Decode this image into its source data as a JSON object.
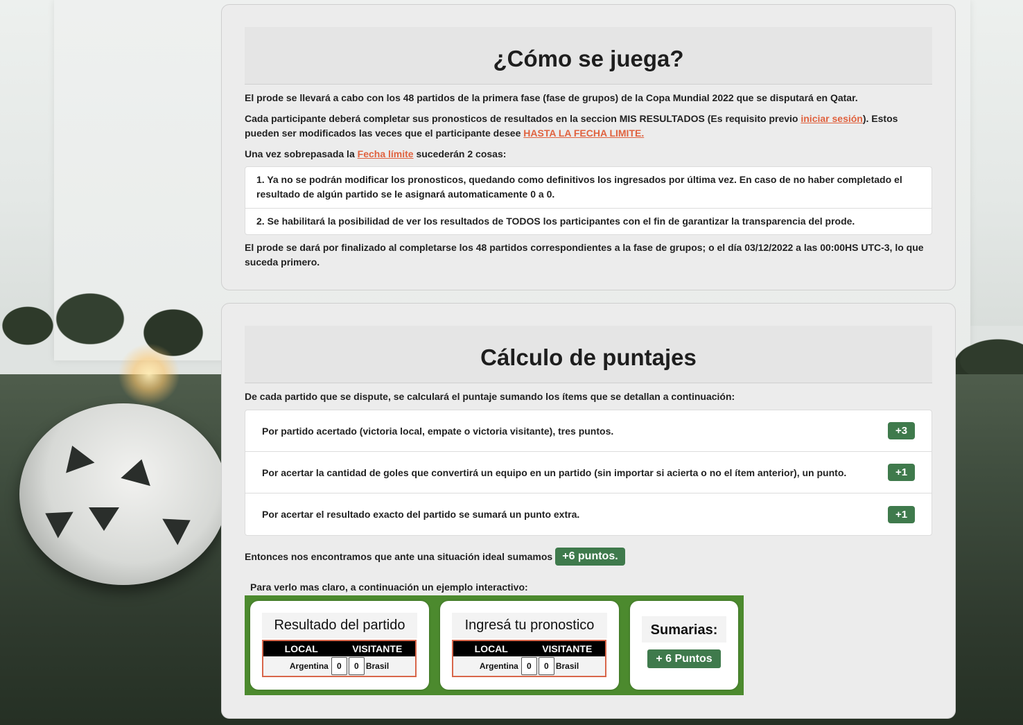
{
  "how_to_play": {
    "title": "¿Cómo se juega?",
    "p1": "El prode se llevará a cabo con los 48 partidos de la primera fase (fase de grupos) de la Copa Mundial 2022 que se disputará en Qatar.",
    "p2_a": "Cada participante deberá completar sus pronosticos de resultados en la seccion MIS RESULTADOS (Es requisito previo ",
    "p2_link": "iniciar sesión",
    "p2_b": "). Estos pueden ser modificados las veces que el participante desee ",
    "p2_link2": "HASTA LA FECHA LIMITE.",
    "p3_a": "Una vez sobrepasada la ",
    "p3_link": "Fecha límite",
    "p3_b": " sucederán 2 cosas:",
    "items": [
      "1. Ya no se podrán modificar los pronosticos, quedando como definitivos los ingresados por última vez. En caso de no haber completado el resultado de algún partido se le asignará automaticamente 0 a 0.",
      "2. Se habilitará la posibilidad de ver los resultados de TODOS los participantes con el fin de garantizar la transparencia del prode."
    ],
    "p4": "El prode se dará por finalizado al completarse los 48 partidos correspondientes a la fase de grupos; o el día 03/12/2022 a las 00:00HS UTC-3, lo que suceda primero."
  },
  "scoring": {
    "title": "Cálculo de puntajes",
    "intro": "De cada partido que se dispute, se calculará el puntaje sumando los ítems que se detallan a continuación:",
    "items": [
      {
        "text": "Por partido acertado (victoria local, empate o victoria visitante), tres puntos.",
        "points": "+3"
      },
      {
        "text": "Por acertar la cantidad de goles que convertirá un equipo en un partido (sin importar si acierta o no el ítem anterior), un punto.",
        "points": "+1"
      },
      {
        "text": "Por acertar el resultado exacto del partido se sumará un punto extra.",
        "points": "+1"
      }
    ],
    "ideal_text": "Entonces nos encontramos que ante una situación ideal sumamos",
    "ideal_badge": "+6 puntos.",
    "example_label": "Para verlo mas claro, a continuación un ejemplo interactivo:",
    "result_panel": {
      "title": "Resultado del partido",
      "local_header": "LOCAL",
      "visit_header": "VISITANTE",
      "local_team": "Argentina",
      "local_score": "0",
      "visit_score": "0",
      "visit_team": "Brasil"
    },
    "prediction_panel": {
      "title": "Ingresá tu pronostico",
      "local_header": "LOCAL",
      "visit_header": "VISITANTE",
      "local_team": "Argentina",
      "local_score": "0",
      "visit_score": "0",
      "visit_team": "Brasil"
    },
    "summary_panel": {
      "title": "Sumarias:",
      "total": "+ 6 Puntos"
    }
  },
  "colors": {
    "accent_link": "#e0623f",
    "badge_green": "#3f7a4c",
    "example_bg": "#4c8a2e"
  }
}
